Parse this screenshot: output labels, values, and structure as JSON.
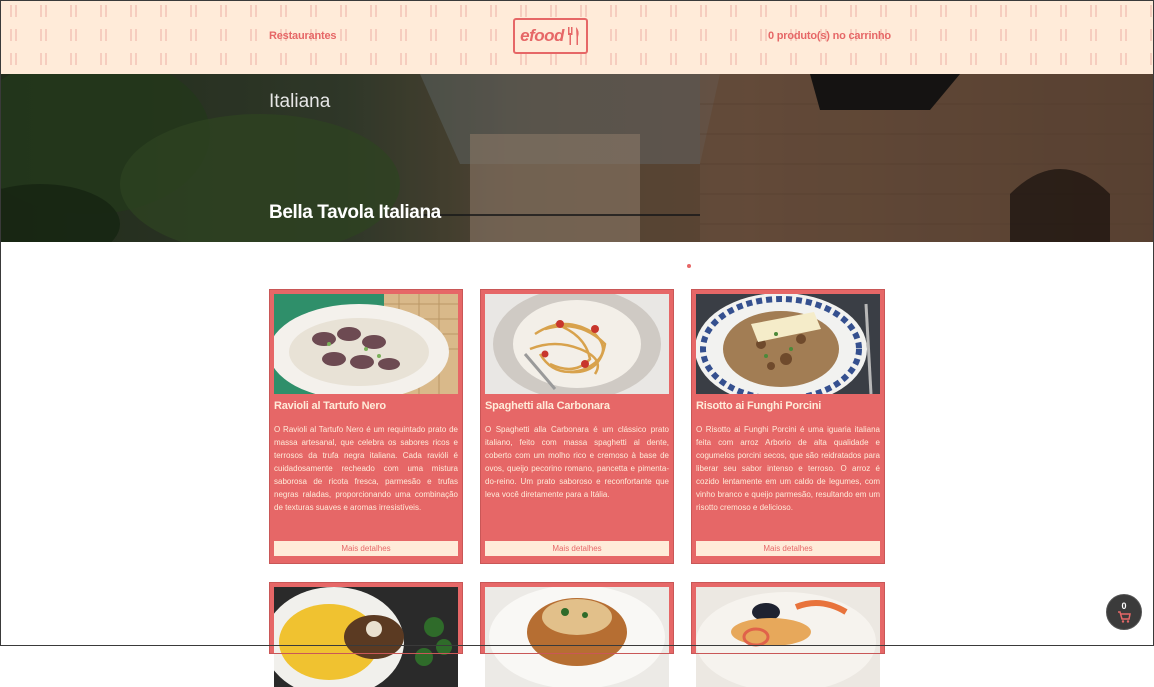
{
  "header": {
    "restaurants_label": "Restaurantes",
    "logo_text": "efood",
    "cart_label": "0 produto(s) no carrinho"
  },
  "hero": {
    "type": "Italiana",
    "title": "Bella Tavola Italiana"
  },
  "menu": {
    "button_label": "Mais detalhes",
    "items": [
      {
        "title": "Ravioli al Tartufo Nero",
        "description": "O Ravioli al Tartufo Nero é um requintado prato de massa artesanal, que celebra os sabores ricos e terrosos da trufa negra italiana. Cada ravióli é cuidadosamente recheado com uma mistura saborosa de ricota fresca, parmesão e trufas negras raladas, proporcionando uma combinação de texturas suaves e aromas irresistíveis."
      },
      {
        "title": "Spaghetti alla Carbonara",
        "description": "O Spaghetti alla Carbonara é um clássico prato italiano, feito com massa spaghetti al dente, coberto com um molho rico e cremoso à base de ovos, queijo pecorino romano, pancetta e pimenta-do-reino. Um prato saboroso e reconfortante que leva você diretamente para a Itália."
      },
      {
        "title": "Risotto ai Funghi Porcini",
        "description": "O Risotto ai Funghi Porcini é uma iguaria italiana feita com arroz Arborio de alta qualidade e cogumelos porcini secos, que são reidratados para liberar seu sabor intenso e terroso. O arroz é cozido lentamente em um caldo de legumes, com vinho branco e queijo parmesão, resultando em um risotto cremoso e delicioso."
      }
    ]
  },
  "cart_fab": {
    "count": "0"
  },
  "colors": {
    "primary": "#E66767",
    "secondary": "#FFEBD9"
  }
}
